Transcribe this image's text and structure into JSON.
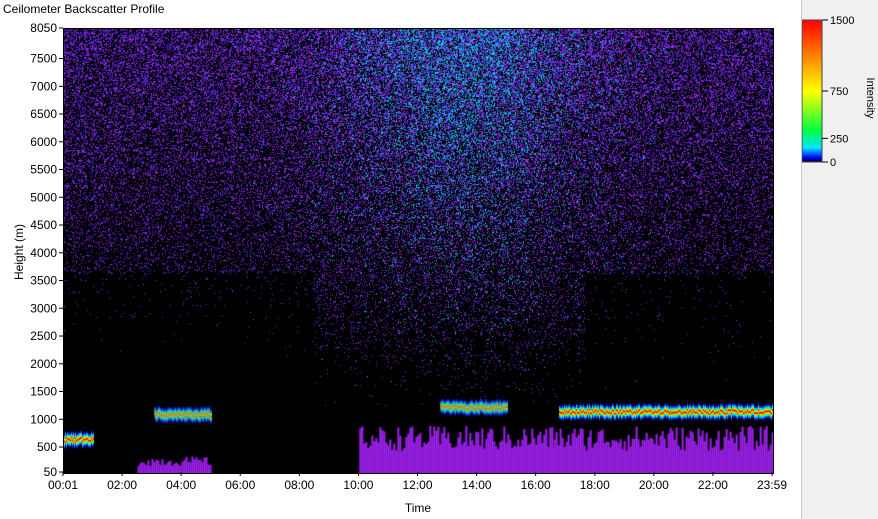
{
  "window": {
    "title": "Ceilometer Backscatter Profile"
  },
  "chart_data": {
    "type": "heatmap",
    "title": "Ceilometer Backscatter Profile",
    "xlabel": "Time",
    "ylabel": "Height (m)",
    "colorbar_label": "Intensity",
    "x_ticks": [
      "00:01",
      "02:00",
      "04:00",
      "06:00",
      "08:00",
      "10:00",
      "12:00",
      "14:00",
      "16:00",
      "18:00",
      "20:00",
      "22:00",
      "23:59"
    ],
    "y_ticks": [
      50,
      500,
      1000,
      1500,
      2000,
      2500,
      3000,
      3500,
      4000,
      4500,
      5000,
      5500,
      6000,
      6500,
      7000,
      7500,
      8050
    ],
    "ylim": [
      50,
      8050
    ],
    "colorbar_ticks": [
      0,
      250,
      750,
      1500
    ],
    "colorbar_range": [
      0,
      1500
    ],
    "colorscale": [
      "#000000",
      "#1a1aff",
      "#00e5ff",
      "#00ff40",
      "#ffff00",
      "#ff8000",
      "#ff0000"
    ],
    "layers": [
      {
        "name": "cloud-top-band",
        "segments": [
          {
            "t_start": "00:01",
            "t_end": "01:00",
            "height_m": 650
          },
          {
            "t_start": "03:05",
            "t_end": "05:00",
            "height_m": 1100
          },
          {
            "t_start": "12:45",
            "t_end": "15:00",
            "height_m": 1230
          },
          {
            "t_start": "16:45",
            "t_end": "23:59",
            "height_m": 1150
          }
        ]
      }
    ]
  }
}
